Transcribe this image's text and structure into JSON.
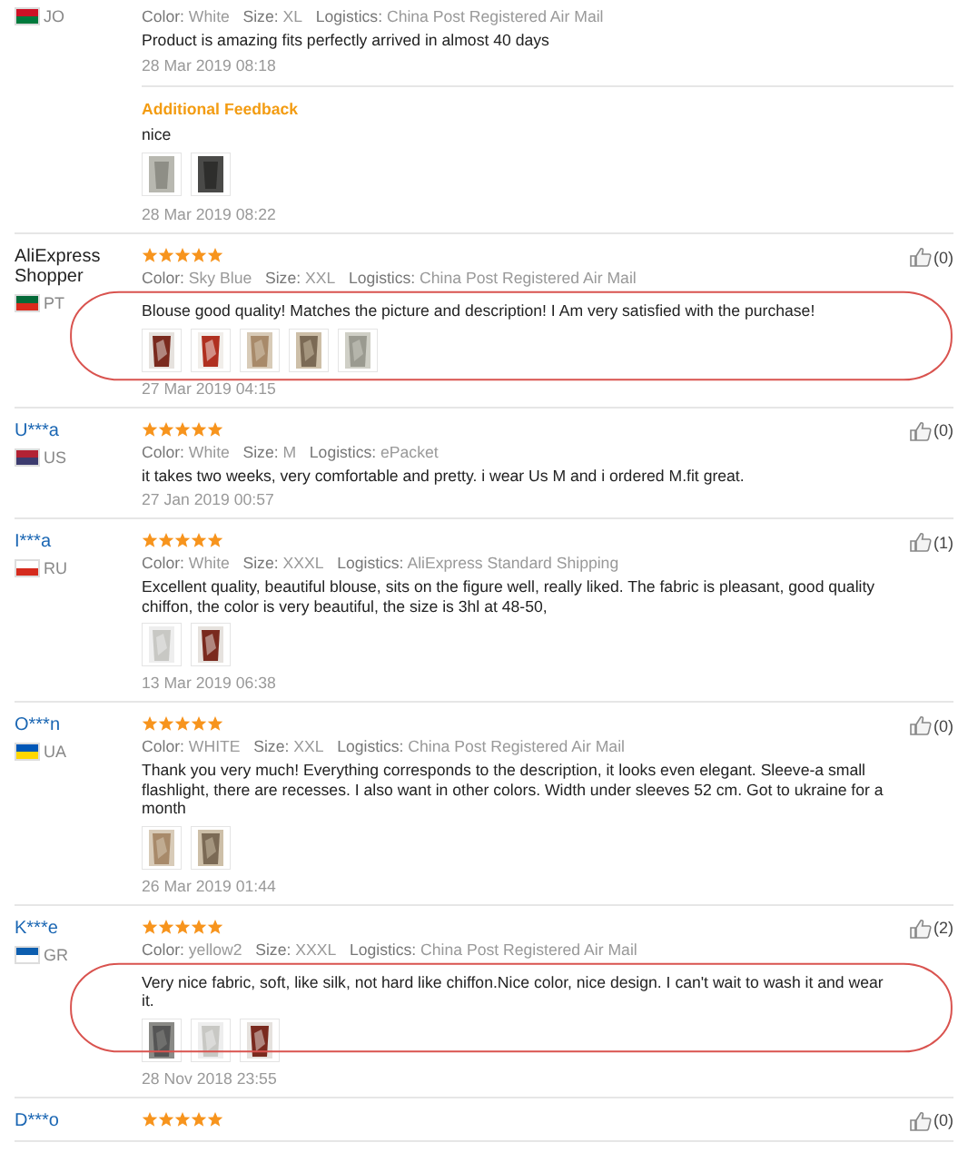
{
  "reviews": [
    {
      "country": "JO",
      "color_label": "Color:",
      "variant": "White",
      "size_label": "Size:",
      "size": "XL",
      "logistics_label": "Logistics:",
      "logistics": "China Post Registered Air Mail",
      "text": "Product is amazing fits perfectly arrived in almost 40 days",
      "date": "28 Mar 2019 08:18",
      "additional": {
        "title": "Additional Feedback",
        "text": "nice",
        "photos": [
          {
            "kind": "picture"
          },
          {
            "kind": "picture"
          }
        ],
        "date": "28 Mar 2019 08:22"
      }
    },
    {
      "name": "AliExpress Shopper",
      "country": "PT",
      "stars": 5,
      "likes": "(0)",
      "color_label": "Color:",
      "variant": "Sky Blue",
      "size_label": "Size:",
      "size": "XXL",
      "logistics_label": "Logistics:",
      "logistics": "China Post Registered Air Mail",
      "text": "Blouse good quality! Matches the picture and description! I Am very satisfied with the purchase!",
      "photos": [
        {
          "kind": "picture"
        },
        {
          "kind": "picture"
        },
        {
          "kind": "picture"
        },
        {
          "kind": "picture"
        },
        {
          "kind": "picture"
        }
      ],
      "date": "27 Mar 2019 04:15",
      "circled": true
    },
    {
      "name": "U***a",
      "country": "US",
      "stars": 5,
      "likes": "(0)",
      "color_label": "Color:",
      "variant": "White",
      "size_label": "Size:",
      "size": "M",
      "logistics_label": "Logistics:",
      "logistics": "ePacket",
      "text": "it takes two weeks, very comfortable and pretty. i wear Us M and i ordered M.fit great.",
      "date": "27 Jan 2019 00:57"
    },
    {
      "name": "I***a",
      "country": "RU",
      "stars": 5,
      "likes": "(1)",
      "color_label": "Color:",
      "variant": "White",
      "size_label": "Size:",
      "size": "XXXL",
      "logistics_label": "Logistics:",
      "logistics": "AliExpress Standard Shipping",
      "text": "Excellent quality, beautiful blouse, sits on the figure well, really liked. The fabric is pleasant, good quality chiffon, the color is very beautiful, the size is 3hl at 48-50,",
      "photos": [
        {
          "kind": "picture"
        },
        {
          "kind": "picture"
        }
      ],
      "date": "13 Mar 2019 06:38"
    },
    {
      "name": "O***n",
      "country": "UA",
      "stars": 5,
      "likes": "(0)",
      "color_label": "Color:",
      "variant": "WHITE",
      "size_label": "Size:",
      "size": "XXL",
      "logistics_label": "Logistics:",
      "logistics": "China Post Registered Air Mail",
      "text": "Thank you very much! Everything corresponds to the description, it looks even elegant. Sleeve-a small flashlight, there are recesses. I also want in other colors. Width under sleeves 52 cm. Got to ukraine for a month",
      "photos": [
        {
          "kind": "picture"
        },
        {
          "kind": "picture"
        }
      ],
      "date": "26 Mar 2019 01:44"
    },
    {
      "name": "K***e",
      "country": "GR",
      "stars": 5,
      "likes": "(2)",
      "color_label": "Color:",
      "variant": "yellow2",
      "size_label": "Size:",
      "size": "XXXL",
      "logistics_label": "Logistics:",
      "logistics": "China Post Registered Air Mail",
      "text": "Very nice fabric, soft, like silk, not hard like chiffon.Nice color, nice design. I can't wait to wash it and wear it.",
      "photos": [
        {
          "kind": "picture"
        },
        {
          "kind": "picture"
        },
        {
          "kind": "picture"
        }
      ],
      "date": "28 Nov 2018 23:55",
      "circled": true
    },
    {
      "name": "D***o",
      "stars": 5,
      "likes": "(0)"
    }
  ]
}
